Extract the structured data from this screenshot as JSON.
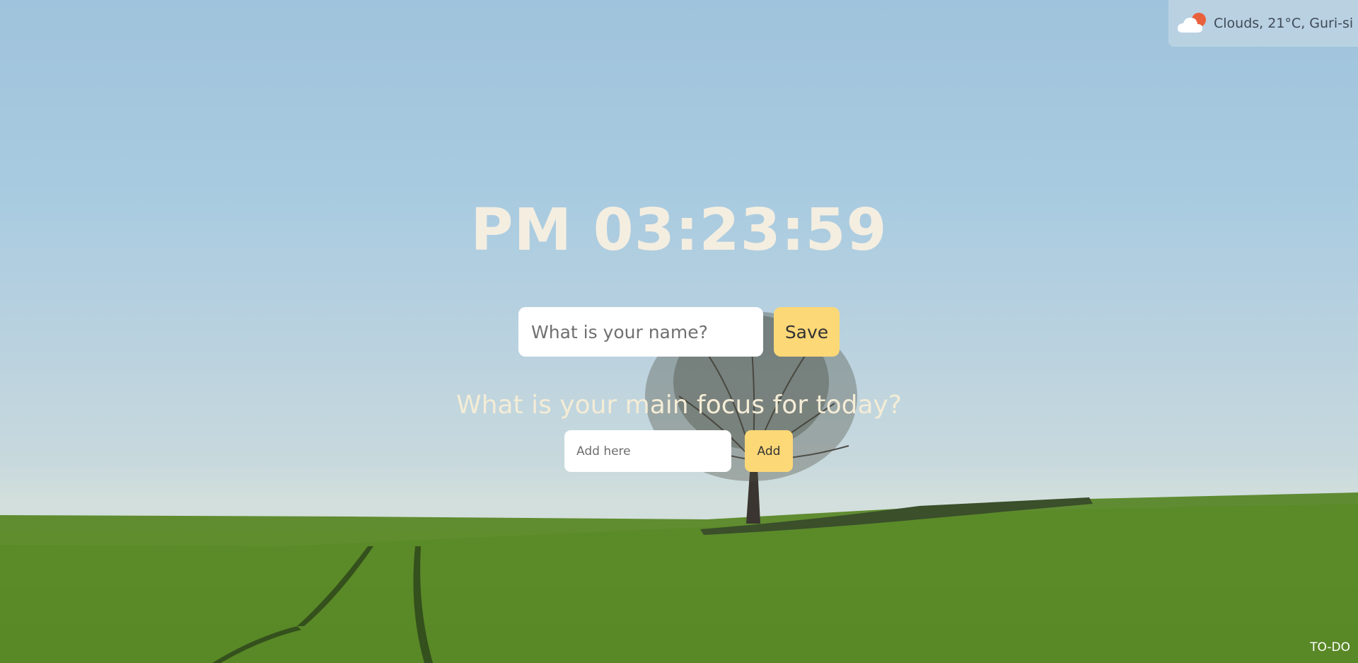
{
  "weather": {
    "icon": "partly-cloudy-icon",
    "text": "Clouds, 21°C, Guri-si"
  },
  "clock": {
    "time": "PM 03:23:59"
  },
  "name_form": {
    "placeholder": "What is your name?",
    "save_label": "Save"
  },
  "focus": {
    "question": "What is your main focus for today?",
    "placeholder": "Add here",
    "add_label": "Add"
  },
  "footer": {
    "todo_label": "TO-DO"
  },
  "colors": {
    "accent": "#fdd877",
    "clock_text": "#f4eee1",
    "sky": "#a9cbe0",
    "field": "#5d8a2a"
  }
}
